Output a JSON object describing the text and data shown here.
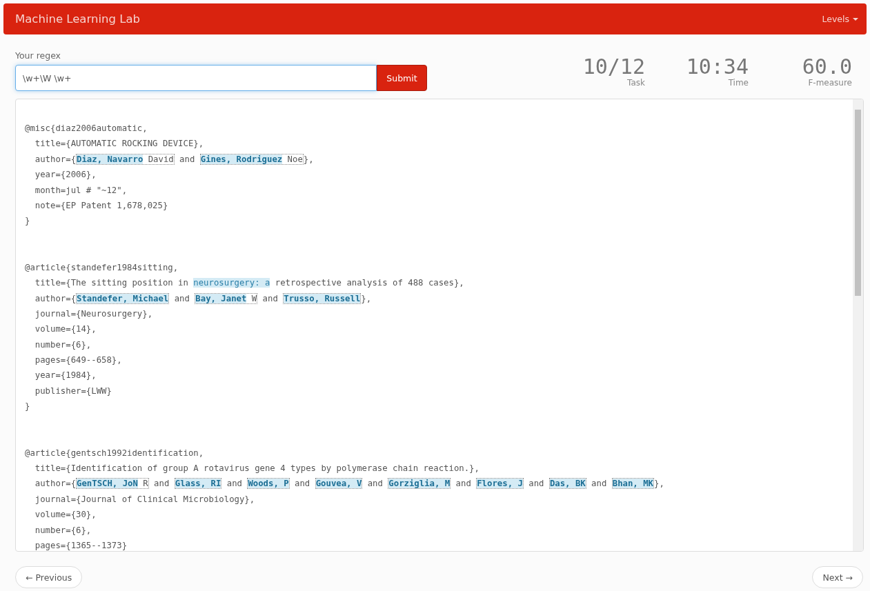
{
  "navbar": {
    "brand": "Machine Learning Lab",
    "menu": "Levels"
  },
  "regex": {
    "label": "Your regex",
    "value": "\\w+\\W \\w+",
    "submit": "Submit"
  },
  "stats": [
    {
      "value": "10/12",
      "label": "Task"
    },
    {
      "value": "10:34",
      "label": "Time"
    },
    {
      "value": "60.0",
      "label": "F-measure"
    }
  ],
  "entries": [
    {
      "lines": [
        [
          {
            "kind": "plain",
            "text": "@misc{diaz2006automatic,"
          }
        ],
        [
          {
            "kind": "plain",
            "text": "  title={AUTOMATIC ROCKING DEVICE},"
          }
        ],
        [
          {
            "kind": "plain",
            "text": "  author={"
          },
          {
            "kind": "expected",
            "parts": [
              {
                "text": "Diaz, Navarro",
                "matched": true
              },
              {
                "text": " David",
                "matched": false
              }
            ]
          },
          {
            "kind": "plain",
            "text": " and "
          },
          {
            "kind": "expected",
            "parts": [
              {
                "text": "Gines, Rodriguez",
                "matched": true
              },
              {
                "text": " Noe",
                "matched": false
              }
            ]
          },
          {
            "kind": "plain",
            "text": "},"
          }
        ],
        [
          {
            "kind": "plain",
            "text": "  year={2006},"
          }
        ],
        [
          {
            "kind": "plain",
            "text": "  month=jul # \"~12\","
          }
        ],
        [
          {
            "kind": "plain",
            "text": "  note={EP Patent 1,678,025}"
          }
        ],
        [
          {
            "kind": "plain",
            "text": "}"
          }
        ]
      ]
    },
    {
      "lines": [
        [
          {
            "kind": "plain",
            "text": "@article{standefer1984sitting,"
          }
        ],
        [
          {
            "kind": "plain",
            "text": "  title={The sitting position in "
          },
          {
            "kind": "false_match",
            "text": "neurosurgery: a"
          },
          {
            "kind": "plain",
            "text": " retrospective analysis of 488 cases},"
          }
        ],
        [
          {
            "kind": "plain",
            "text": "  author={"
          },
          {
            "kind": "expected",
            "parts": [
              {
                "text": "Standefer, Michael",
                "matched": true
              }
            ]
          },
          {
            "kind": "plain",
            "text": " and "
          },
          {
            "kind": "expected",
            "parts": [
              {
                "text": "Bay, Janet",
                "matched": true
              },
              {
                "text": " W",
                "matched": false
              }
            ]
          },
          {
            "kind": "plain",
            "text": " and "
          },
          {
            "kind": "expected",
            "parts": [
              {
                "text": "Trusso, Russell",
                "matched": true
              }
            ]
          },
          {
            "kind": "plain",
            "text": "},"
          }
        ],
        [
          {
            "kind": "plain",
            "text": "  journal={Neurosurgery},"
          }
        ],
        [
          {
            "kind": "plain",
            "text": "  volume={14},"
          }
        ],
        [
          {
            "kind": "plain",
            "text": "  number={6},"
          }
        ],
        [
          {
            "kind": "plain",
            "text": "  pages={649--658},"
          }
        ],
        [
          {
            "kind": "plain",
            "text": "  year={1984},"
          }
        ],
        [
          {
            "kind": "plain",
            "text": "  publisher={LWW}"
          }
        ],
        [
          {
            "kind": "plain",
            "text": "}"
          }
        ]
      ]
    },
    {
      "lines": [
        [
          {
            "kind": "plain",
            "text": "@article{gentsch1992identification,"
          }
        ],
        [
          {
            "kind": "plain",
            "text": "  title={Identification of group A rotavirus gene 4 types by polymerase chain reaction.},"
          }
        ],
        [
          {
            "kind": "plain",
            "text": "  author={"
          },
          {
            "kind": "expected",
            "parts": [
              {
                "text": "GenTSCH, JoN",
                "matched": true
              },
              {
                "text": " R",
                "matched": false
              }
            ]
          },
          {
            "kind": "plain",
            "text": " and "
          },
          {
            "kind": "expected",
            "parts": [
              {
                "text": "Glass, RI",
                "matched": true
              }
            ]
          },
          {
            "kind": "plain",
            "text": " and "
          },
          {
            "kind": "expected",
            "parts": [
              {
                "text": "Woods, P",
                "matched": true
              }
            ]
          },
          {
            "kind": "plain",
            "text": " and "
          },
          {
            "kind": "expected",
            "parts": [
              {
                "text": "Gouvea, V",
                "matched": true
              }
            ]
          },
          {
            "kind": "plain",
            "text": " and "
          },
          {
            "kind": "expected",
            "parts": [
              {
                "text": "Gorziglia, M",
                "matched": true
              }
            ]
          },
          {
            "kind": "plain",
            "text": " and "
          },
          {
            "kind": "expected",
            "parts": [
              {
                "text": "Flores, J",
                "matched": true
              }
            ]
          },
          {
            "kind": "plain",
            "text": " and "
          },
          {
            "kind": "expected",
            "parts": [
              {
                "text": "Das, BK",
                "matched": true
              }
            ]
          },
          {
            "kind": "plain",
            "text": " and "
          },
          {
            "kind": "expected",
            "parts": [
              {
                "text": "Bhan, MK",
                "matched": true
              }
            ]
          },
          {
            "kind": "plain",
            "text": "},"
          }
        ],
        [
          {
            "kind": "plain",
            "text": "  journal={Journal of Clinical Microbiology},"
          }
        ],
        [
          {
            "kind": "plain",
            "text": "  volume={30},"
          }
        ],
        [
          {
            "kind": "plain",
            "text": "  number={6},"
          }
        ],
        [
          {
            "kind": "plain",
            "text": "  pages={1365--1373}"
          }
        ]
      ]
    }
  ],
  "pager": {
    "previous": "← Previous",
    "next": "Next →"
  }
}
